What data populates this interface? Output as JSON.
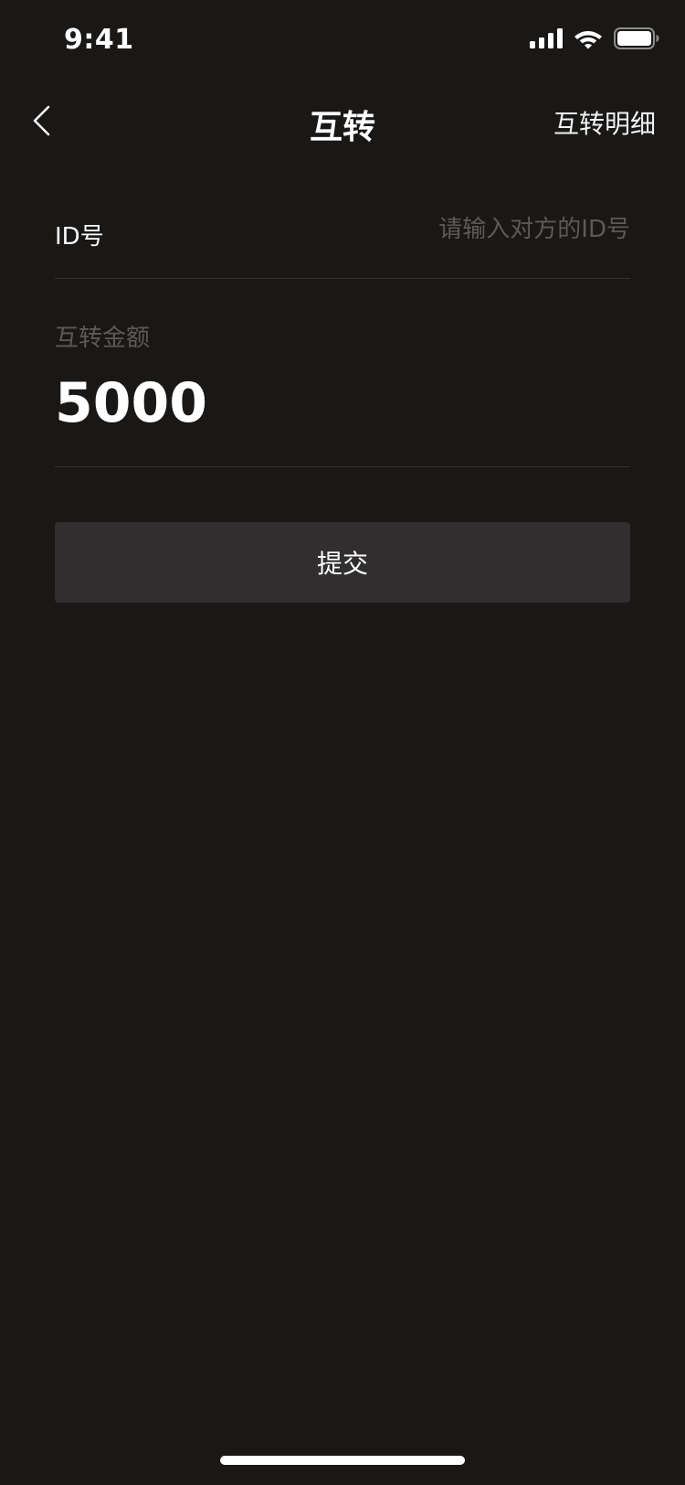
{
  "status_bar": {
    "time": "9:41",
    "icons": [
      "cellular-signal-icon",
      "wifi-icon",
      "battery-icon"
    ]
  },
  "nav": {
    "title": "互转",
    "detail_link": "互转明细",
    "back_icon": "chevron-left-icon"
  },
  "form": {
    "id_label": "ID号",
    "id_placeholder": "请输入对方的ID号",
    "amount_label": "互转金额",
    "amount_value": "5000",
    "submit_label": "提交"
  },
  "colors": {
    "background": "#191817",
    "button_background": "#302e2f",
    "placeholder_text": "#5c5a57",
    "divider": "#34322f"
  }
}
